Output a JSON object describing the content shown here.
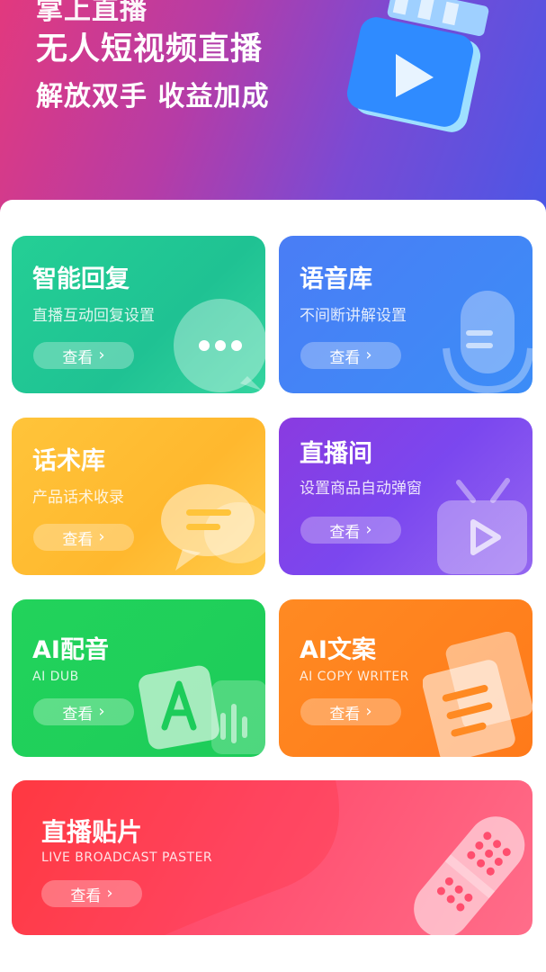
{
  "hero": {
    "line1": "掌上直播",
    "line2": "无人短视频直播",
    "line3": "解放双手 收益加成"
  },
  "cards": [
    {
      "title": "智能回复",
      "subtitle": "直播互动回复设置",
      "button": "查看"
    },
    {
      "title": "语音库",
      "subtitle": "不间断讲解设置",
      "button": "查看"
    },
    {
      "title": "话术库",
      "subtitle": "产品话术收录",
      "button": "查看"
    },
    {
      "title": "直播间",
      "subtitle": "设置商品自动弹窗",
      "button": "查看"
    },
    {
      "title": "AI配音",
      "subtitle": "AI DUB",
      "button": "查看"
    },
    {
      "title": "AI文案",
      "subtitle": "AI COPY WRITER",
      "button": "查看"
    },
    {
      "title": "直播贴片",
      "subtitle": "LIVE BROADCAST PASTER",
      "button": "查看"
    }
  ],
  "icons": {
    "button_chevron": "chevron-right-icon",
    "hero": "video-play-icon",
    "card1": "chat-bubble-icon",
    "card2": "microphone-icon",
    "card3": "message-bubbles-icon",
    "card4": "tv-play-icon",
    "card5": "letter-a-icon",
    "card6": "documents-icon",
    "card7": "bandage-patch-icon"
  },
  "colors": {
    "smart_reply": "#24cf95",
    "voice_library": "#4a7df5",
    "script_library": "#ffc43a",
    "live_room": "#7b47ef",
    "ai_dub": "#22d35b",
    "ai_copywriter": "#ff8a22",
    "live_paster": "#ff4e6e"
  }
}
